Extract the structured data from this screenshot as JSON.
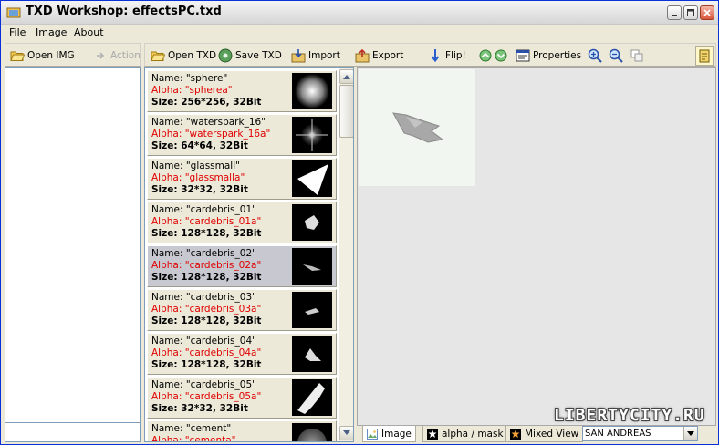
{
  "window": {
    "title": "TXD Workshop: effectsPC.txd"
  },
  "menu": [
    "File",
    "Image",
    "About"
  ],
  "left_toolbar": {
    "open_img": "Open IMG",
    "action": "Action"
  },
  "main_toolbar": {
    "open_txd": "Open TXD",
    "save_txd": "Save TXD",
    "import": "Import",
    "export": "Export",
    "flip": "Flip!",
    "properties": "Properties"
  },
  "textures": [
    {
      "name": "Name: \"sphere\"",
      "alpha": "Alpha: \"spherea\"",
      "size": "Size: 256*256, 32Bit",
      "thumb": "sphere"
    },
    {
      "name": "Name: \"waterspark_16\"",
      "alpha": "Alpha: \"waterspark_16a\"",
      "size": "Size: 64*64, 32Bit",
      "thumb": "spark"
    },
    {
      "name": "Name: \"glassmall\"",
      "alpha": "Alpha: \"glassmalla\"",
      "size": "Size: 32*32, 32Bit",
      "thumb": "glass"
    },
    {
      "name": "Name: \"cardebris_01\"",
      "alpha": "Alpha: \"cardebris_01a\"",
      "size": "Size: 128*128, 32Bit",
      "thumb": "debris1"
    },
    {
      "name": "Name: \"cardebris_02\"",
      "alpha": "Alpha: \"cardebris_02a\"",
      "size": "Size: 128*128, 32Bit",
      "thumb": "debris2",
      "selected": true
    },
    {
      "name": "Name: \"cardebris_03\"",
      "alpha": "Alpha: \"cardebris_03a\"",
      "size": "Size: 128*128, 32Bit",
      "thumb": "debris3"
    },
    {
      "name": "Name: \"cardebris_04\"",
      "alpha": "Alpha: \"cardebris_04a\"",
      "size": "Size: 128*128, 32Bit",
      "thumb": "debris4"
    },
    {
      "name": "Name: \"cardebris_05\"",
      "alpha": "Alpha: \"cardebris_05a\"",
      "size": "Size: 32*32, 32Bit",
      "thumb": "debris5"
    },
    {
      "name": "Name: \"cement\"",
      "alpha": "Alpha: \"cementa\"",
      "size": "",
      "thumb": "cement"
    }
  ],
  "tabs": {
    "image": "Image",
    "alpha": "alpha / mask",
    "mixed": "Mixed View"
  },
  "game_select": {
    "value": "SAN ANDREAS"
  },
  "watermark": "LIBERTYCITY.RU",
  "colors": {
    "alpha_text": "#e00000",
    "title_bar": "#e2e2e2",
    "selected_item": "#c8c8d0"
  }
}
